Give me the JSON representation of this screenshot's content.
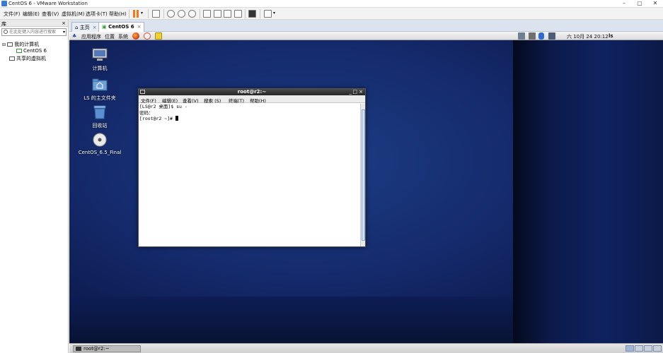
{
  "window": {
    "title": "CentOS 6 - VMware Workstation",
    "minimize": "–",
    "maximize": "▢",
    "close": "✕"
  },
  "menubar": {
    "items": [
      "文件(F)",
      "编辑(E)",
      "查看(V)",
      "虚拟机(M)",
      "选项卡(T)",
      "帮助(H)"
    ]
  },
  "library": {
    "header": "库",
    "close": "×",
    "search_placeholder": "在此处键入内容进行搜索",
    "tree": {
      "my_computer": "我的计算机",
      "vm": "CentOS 6",
      "shared": "共享的虚拟机"
    }
  },
  "tabs": [
    {
      "label": "主页",
      "close": "×"
    },
    {
      "label": "CentOS 6",
      "close": "×"
    }
  ],
  "gnome_panel": {
    "applications": "应用程序",
    "places": "位置",
    "system": "系统",
    "clock": "六 10月 24 20:12",
    "user": "ls"
  },
  "desktop_icons": [
    {
      "label": "计算机",
      "icon": "computer-icon"
    },
    {
      "label": "LS 的主文件夹",
      "icon": "home-folder-icon"
    },
    {
      "label": "回收站",
      "icon": "trash-icon"
    },
    {
      "label": "CentOS_6.5_Final",
      "icon": "disc-icon"
    }
  ],
  "terminal": {
    "title": "root@r2:~",
    "menu": [
      "文件(F)",
      "编辑(E)",
      "查看(V)",
      "搜索 (S)",
      "终端(T)",
      "帮助(H)"
    ],
    "lines": [
      "[LS@r2 桌面]$ su -",
      "密码：",
      "[root@r2 ~]# "
    ]
  },
  "taskbar": {
    "task": "root@r2:~"
  },
  "colors": {
    "desktop": "#14296a",
    "terminal_title": "#262626",
    "pause_orange": "#f07a1b"
  }
}
